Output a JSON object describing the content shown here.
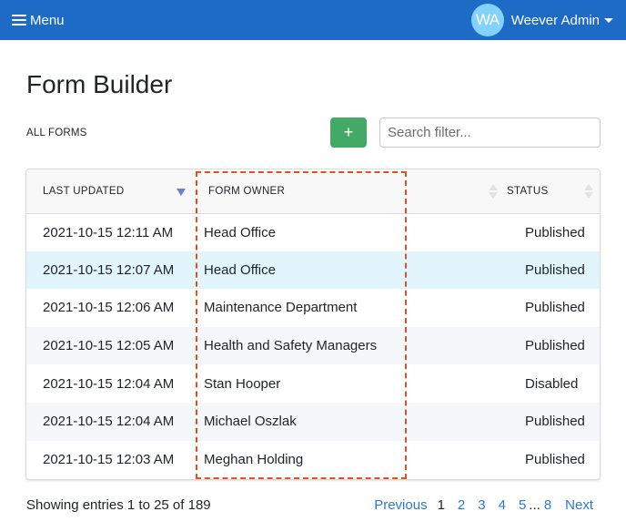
{
  "topbar": {
    "menu_label": "Menu",
    "avatar_initials": "WA",
    "user_name": "Weever Admin",
    "brand_color": "#1e6bc6",
    "avatar_color": "#82d2fb"
  },
  "page": {
    "title": "Form Builder",
    "section_label": "ALL FORMS"
  },
  "toolbar": {
    "add_label": "+",
    "search_placeholder": "Search filter...",
    "search_value": "",
    "add_color": "#44a866"
  },
  "table": {
    "columns": [
      {
        "label": "LAST UPDATED",
        "sort": "descending"
      },
      {
        "label": "FORM OWNER",
        "sort": "none"
      },
      {
        "label": "STATUS",
        "sort": "none"
      }
    ],
    "rows": [
      {
        "last_updated": "2021-10-15 12:11 AM",
        "owner": "Head Office",
        "status": "Published",
        "highlighted": false
      },
      {
        "last_updated": "2021-10-15 12:07 AM",
        "owner": "Head Office",
        "status": "Published",
        "highlighted": true
      },
      {
        "last_updated": "2021-10-15 12:06 AM",
        "owner": "Maintenance Department",
        "status": "Published",
        "highlighted": false
      },
      {
        "last_updated": "2021-10-15 12:05 AM",
        "owner": "Health and Safety Managers",
        "status": "Published",
        "highlighted": false
      },
      {
        "last_updated": "2021-10-15 12:04 AM",
        "owner": "Stan Hooper",
        "status": "Disabled",
        "highlighted": false
      },
      {
        "last_updated": "2021-10-15 12:04 AM",
        "owner": "Michael Oszlak",
        "status": "Published",
        "highlighted": false
      },
      {
        "last_updated": "2021-10-15 12:03 AM",
        "owner": "Meghan Holding",
        "status": "Published",
        "highlighted": false
      }
    ],
    "annotation_color": "#e0521d"
  },
  "footer": {
    "summary": "Showing entries 1 to 25 of 189",
    "pagination": {
      "previous": "Previous",
      "pages": [
        "1",
        "2",
        "3",
        "4",
        "5"
      ],
      "current": "1",
      "ellipsis": "...",
      "last": "8",
      "next": "Next"
    }
  }
}
